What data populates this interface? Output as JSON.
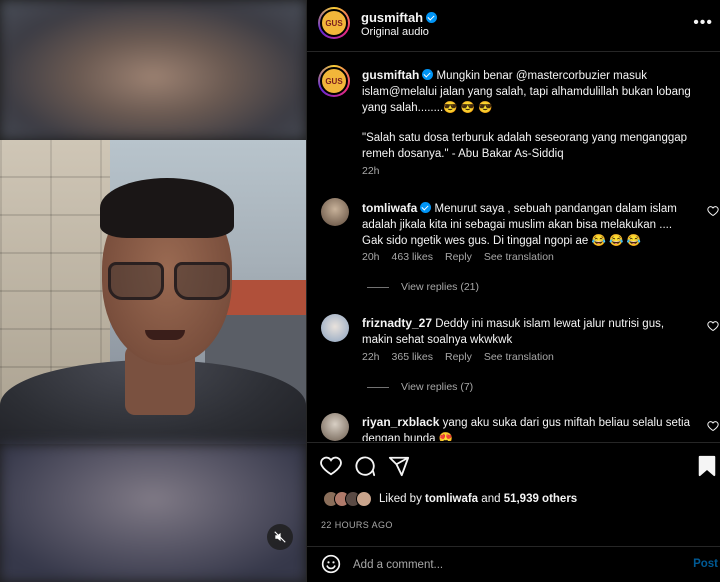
{
  "post": {
    "username": "gusmiftah",
    "audio": "Original audio",
    "avatar_text": "GUS",
    "more_icon": "more-horizontal-icon"
  },
  "caption": {
    "username": "gusmiftah",
    "text_line1": "Mungkin benar @mastercorbuzier masuk",
    "text_line2": "islam@melalui jalan yang salah, tapi alhamdulillah bukan lobang",
    "text_line3": "yang salah........😎 😎 😎",
    "quote_line1": "\"Salah satu dosa terburuk adalah seseorang yang menganggap",
    "quote_line2": "remeh dosanya.\" - Abu Bakar As-Siddiq",
    "time": "22h"
  },
  "comments": [
    {
      "username": "tomliwafa",
      "verified": true,
      "line1": "Menurut saya , sebuah pandangan dalam islam",
      "line2": "adalah jikala kita ini sebagai muslim akan bisa melakukan ....",
      "line3": "Gak sido ngetik wes gus. Di tinggal ngopi ae 😂 😂 😂",
      "time": "20h",
      "likes": "463 likes",
      "reply": "Reply",
      "translate": "See translation",
      "view_replies": "View replies (21)"
    },
    {
      "username": "friznadty_27",
      "verified": false,
      "line1": "Deddy ini masuk islam lewat jalur nutrisi gus,",
      "line2": "makin sehat soalnya wkwkwk",
      "time": "22h",
      "likes": "365 likes",
      "reply": "Reply",
      "translate": "See translation",
      "view_replies": "View replies (7)"
    },
    {
      "username": "riyan_rxblack",
      "verified": false,
      "line1": "yang aku suka dari gus miftah beliau selalu setia",
      "line2": "dengan bunda 😍"
    }
  ],
  "actions": {
    "liked_by_prefix": "Liked by",
    "liked_by_user": "tomliwafa",
    "liked_by_and": "and",
    "liked_by_count": "51,939 others",
    "time_ago": "22 HOURS AGO"
  },
  "add_comment": {
    "placeholder": "Add a comment...",
    "post_label": "Post"
  },
  "colors": {
    "accent": "#0095f6",
    "background": "#000000",
    "secondary_text": "#a8a8a8"
  }
}
